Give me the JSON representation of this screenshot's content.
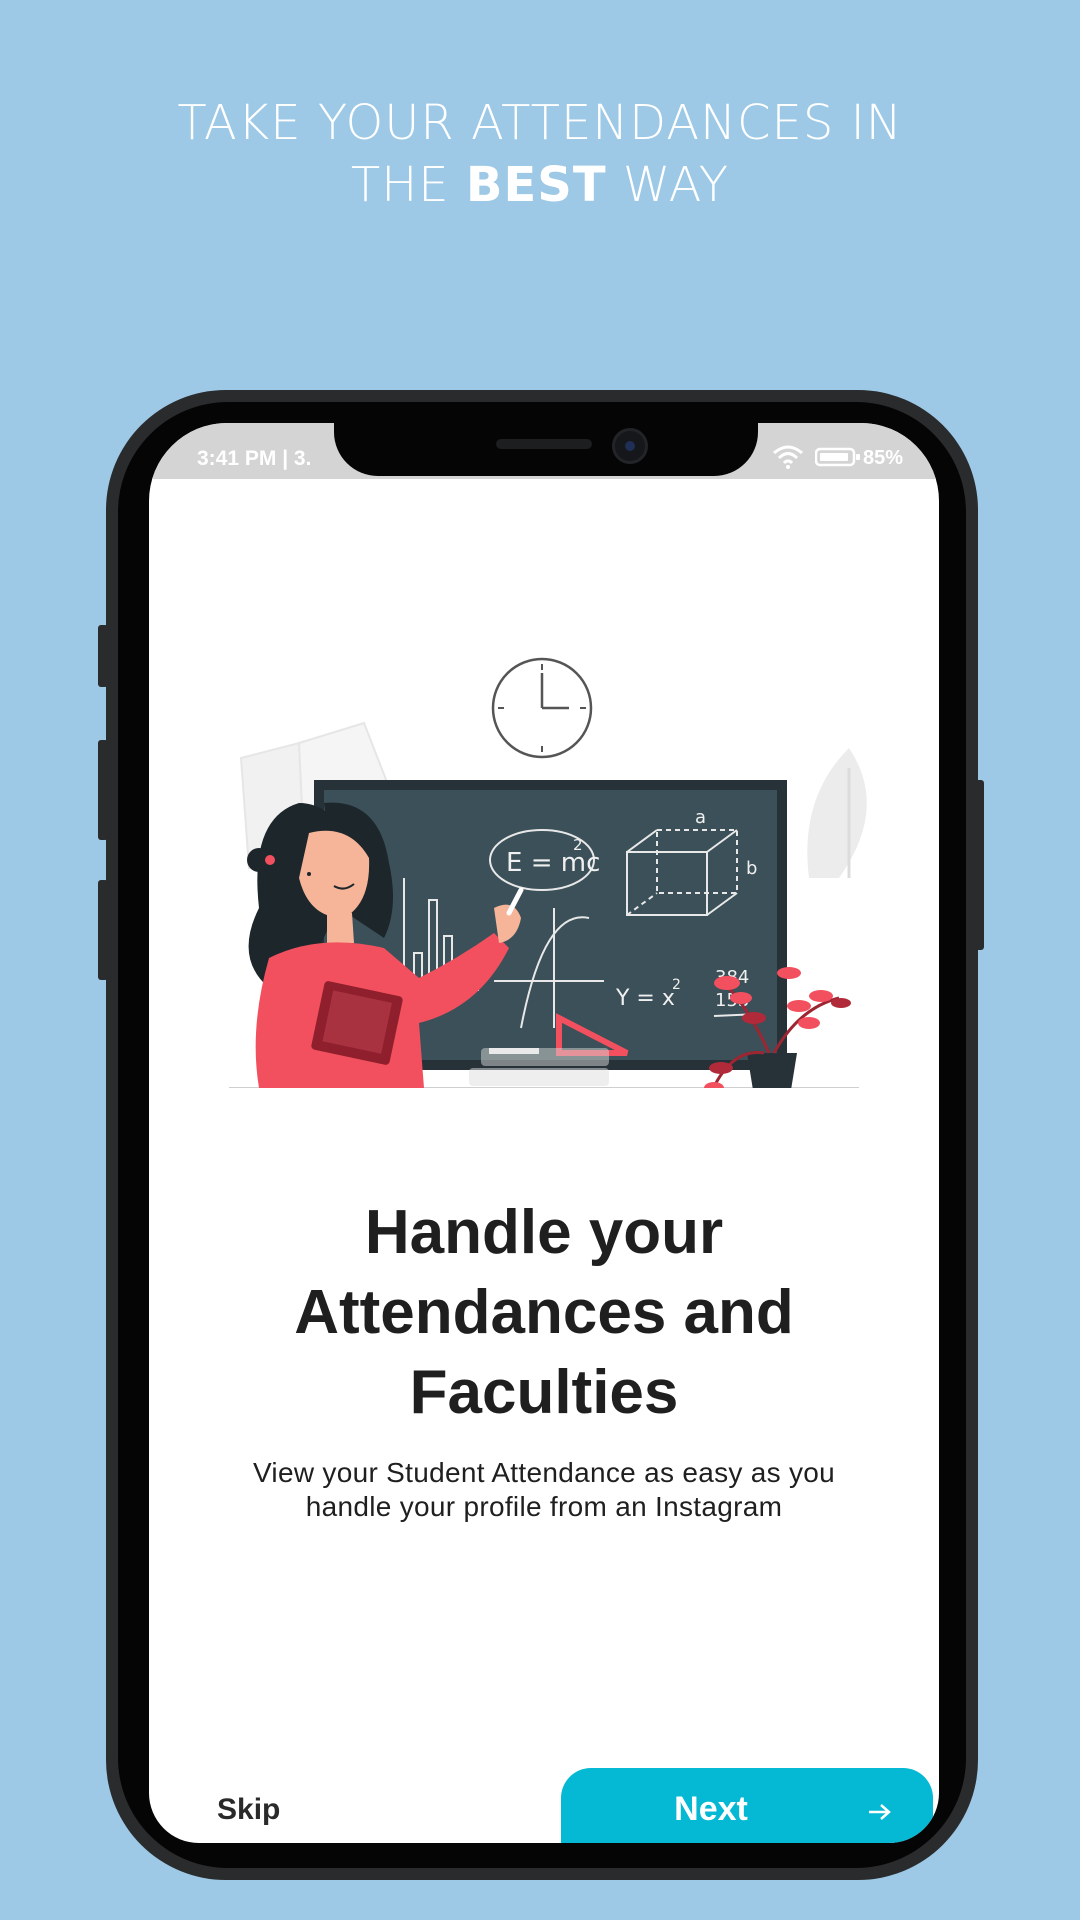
{
  "promo": {
    "line1": "TAKE YOUR ATTENDANCES IN",
    "line2_pre": "THE",
    "line2_bold": "BEST",
    "line2_post": "WAY"
  },
  "status_bar": {
    "time": "3:41 PM | 3.",
    "battery": "85%",
    "icons": [
      "wifi-icon",
      "battery-icon"
    ]
  },
  "illustration": {
    "board_text": [
      "E = mc",
      "2",
      "a",
      "b",
      "Y = x",
      "2",
      "384",
      "153"
    ],
    "icon": "teacher-blackboard-illustration"
  },
  "onboarding": {
    "title": "Handle your Attendances and Faculties",
    "description": "View your Student Attendance as easy as you handle your profile from an Instagram"
  },
  "actions": {
    "skip_label": "Skip",
    "next_label": "Next",
    "next_icon": "arrow-right-icon"
  },
  "colors": {
    "background": "#9dc9e6",
    "accent": "#05b8d3",
    "text": "#1f1f1f"
  }
}
